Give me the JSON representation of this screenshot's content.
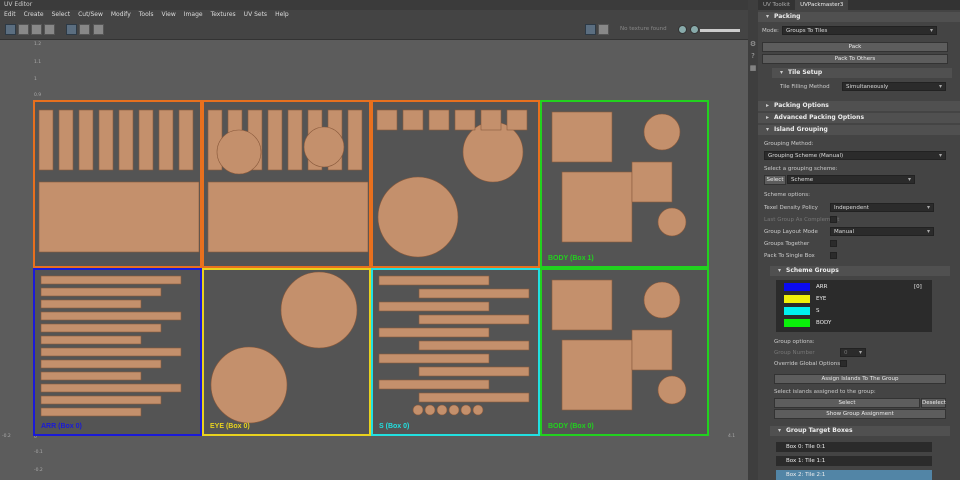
{
  "window": {
    "title": "UV Editor"
  },
  "menu": [
    "Edit",
    "Create",
    "Select",
    "Cut/Sew",
    "Modify",
    "Tools",
    "View",
    "Image",
    "Textures",
    "UV Sets",
    "Help"
  ],
  "toolbar": {
    "texture_status": "No texture found"
  },
  "tiles": [
    {
      "label": "",
      "color": "#e8701e"
    },
    {
      "label": "",
      "color": "#e8701e"
    },
    {
      "label": "",
      "color": "#e8701e"
    },
    {
      "label": "BODY (Box 1)",
      "color": "#22d11f"
    },
    {
      "label": "ARR (Box 0)",
      "color": "#1a1ad8"
    },
    {
      "label": "EYE (Box 0)",
      "color": "#e8d21e"
    },
    {
      "label": "S (Box 0)",
      "color": "#22e0e0"
    },
    {
      "label": "BODY (Box 0)",
      "color": "#22d11f"
    }
  ],
  "axis": {
    "left_ticks": [
      "1.2",
      "1.1",
      "1",
      "0.9",
      "0.1",
      "0",
      "-0.1",
      "-0.2"
    ],
    "right_tick": "4.1",
    "left_tick": "-0.2"
  },
  "panel": {
    "tabs": [
      "UV Toolkit",
      "UVPackmaster3"
    ],
    "packing_header": "Packing",
    "mode_label": "Mode:",
    "mode_value": "Groups To Tiles",
    "pack_btn": "Pack",
    "pack_others_btn": "Pack To Others",
    "tile_setup_header": "Tile Setup",
    "tile_filling_label": "Tile Filling Method",
    "tile_filling_value": "Simultaneously",
    "packing_options": "Packing Options",
    "advanced_options": "Advanced Packing Options",
    "island_grouping": "Island Grouping",
    "grouping_method_label": "Grouping Method:",
    "grouping_method_value": "Grouping Scheme (Manual)",
    "select_scheme_label": "Select a grouping scheme:",
    "select_btn": "Select",
    "scheme_value": "Scheme",
    "scheme_options_label": "Scheme options:",
    "texel_label": "Texel Density Policy",
    "texel_value": "Independent",
    "last_group_label": "Last Group As Complement",
    "layout_mode_label": "Group Layout Mode",
    "layout_mode_value": "Manual",
    "groups_together": "Groups Together",
    "pack_single_box": "Pack To Single Box",
    "scheme_groups_header": "Scheme Groups",
    "groups": [
      {
        "name": "ARR",
        "color": "#0a0af0",
        "index": "[0]"
      },
      {
        "name": "EYE",
        "color": "#f0f00a",
        "index": ""
      },
      {
        "name": "S",
        "color": "#00f0f0",
        "index": ""
      },
      {
        "name": "BODY",
        "color": "#0af00a",
        "index": ""
      }
    ],
    "group_options_label": "Group options:",
    "group_number_label": "Group Number",
    "group_number_value": "0",
    "override_global": "Override Global Options",
    "assign_btn": "Assign Islands To The Group",
    "select_assigned_label": "Select islands assigned to the group:",
    "select_action": "Select",
    "deselect_action": "Deselect",
    "show_assignment_btn": "Show Group Assignment",
    "target_boxes_header": "Group Target Boxes",
    "boxes": [
      "Box 0: Tile 0:1",
      "Box 1: Tile 1:1",
      "Box 2: Tile 2:1"
    ]
  }
}
